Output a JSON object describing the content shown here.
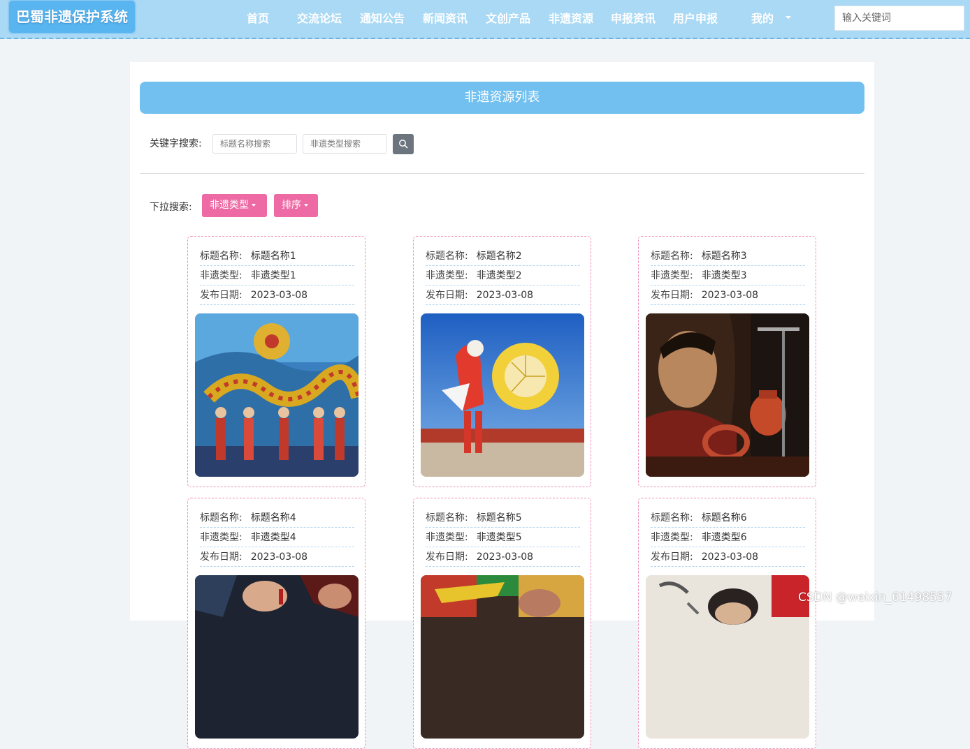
{
  "header": {
    "logo": "巴蜀非遗保护系统",
    "nav": [
      {
        "label": "首页"
      },
      {
        "label": "交流论坛"
      },
      {
        "label": "通知公告"
      },
      {
        "label": "新闻资讯"
      },
      {
        "label": "文创产品"
      },
      {
        "label": "非遗资源"
      },
      {
        "label": "申报资讯"
      },
      {
        "label": "用户申报"
      },
      {
        "label": "我的"
      }
    ],
    "search_placeholder": "输入关键词"
  },
  "main": {
    "title": "非遗资源列表",
    "keyword_label": "关键字搜索:",
    "title_search_placeholder": "标题名称搜索",
    "type_search_placeholder": "非遗类型搜索",
    "dropdown_label": "下拉搜索:",
    "type_dropdown_label": "非遗类型",
    "sort_dropdown_label": "排序",
    "field_labels": {
      "title": "标题名称:",
      "type": "非遗类型:",
      "date": "发布日期:"
    },
    "cards": [
      {
        "title": "标题名称1",
        "type": "非遗类型1",
        "date": "2023-03-08",
        "image": "dragon-dance-photo"
      },
      {
        "title": "标题名称2",
        "type": "非遗类型2",
        "date": "2023-03-08",
        "image": "folk-dance-fan-photo"
      },
      {
        "title": "标题名称3",
        "type": "非遗类型3",
        "date": "2023-03-08",
        "image": "lacquer-craftsman-photo"
      },
      {
        "title": "标题名称4",
        "type": "非遗类型4",
        "date": "2023-03-08",
        "image": "handcraft-photo"
      },
      {
        "title": "标题名称5",
        "type": "非遗类型5",
        "date": "2023-03-08",
        "image": "embroidery-photo"
      },
      {
        "title": "标题名称6",
        "type": "非遗类型6",
        "date": "2023-03-08",
        "image": "calligraphy-photo"
      }
    ]
  },
  "colors": {
    "header_bg": "#a9d9f4",
    "logo_bg": "#59b5ef",
    "title_bar_bg": "#71c0ef",
    "accent_pink": "#ee6aa4",
    "search_button": "#6c757d"
  },
  "icons": {
    "search_button": "search-icon",
    "dropdown_caret": "caret-down-icon"
  },
  "watermark": "CSDN @weixin_61498557"
}
